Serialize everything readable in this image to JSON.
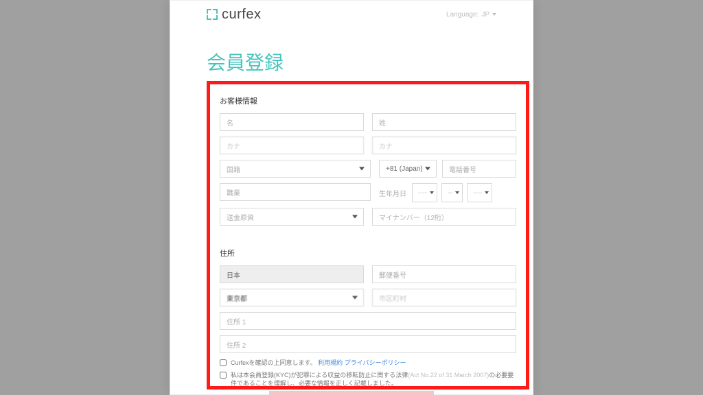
{
  "brand": "curfex",
  "language": {
    "label": "Language:",
    "current": "JP"
  },
  "page_title": "会員登録",
  "sec1_title": "お客様情報",
  "first_name": {
    "ph": "名"
  },
  "last_name": {
    "ph": "姓"
  },
  "first_name_kana": {
    "ph": "カナ"
  },
  "last_name_kana": {
    "ph": "カナ"
  },
  "nationality": {
    "ph": "国籍"
  },
  "dial": {
    "value": "+81 (Japan)"
  },
  "phone": {
    "ph": "電話番号"
  },
  "occupation": {
    "ph": "職業"
  },
  "dob": {
    "label": "生年月日",
    "y": "----",
    "m": "--",
    "d": "----"
  },
  "remit": {
    "ph": "送金原資"
  },
  "mynumber": {
    "ph": "マイナンバー（12桁）"
  },
  "sec2_title": "住所",
  "country": {
    "value": "日本"
  },
  "postal": {
    "ph": "郵便番号"
  },
  "prefecture": {
    "value": "東京都"
  },
  "city": {
    "ph": "市区町村"
  },
  "addr1": {
    "ph": "住所 1"
  },
  "addr2": {
    "ph": "住所 2"
  },
  "chk1": {
    "pre": "Curfexを確認の上同意します。",
    "link1": "利用規約",
    "link2": "プライバシーポリシー"
  },
  "chk2": {
    "pre": "私は本会員登録(KYC)が犯罪による収益の移転防止に関する法律",
    "act": "(Act No.22 of 31 March 2007)",
    "post": "の必要要件であることを理解し、必要な情報を正しく記載しました。"
  }
}
